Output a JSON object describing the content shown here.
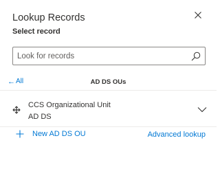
{
  "dialog": {
    "title": "Lookup Records",
    "subtitle": "Select record"
  },
  "search": {
    "placeholder": "Look for records",
    "value": ""
  },
  "nav": {
    "back_label": "All",
    "entity_label": "AD DS OUs"
  },
  "results": [
    {
      "name": "CCS Organizational Unit",
      "subtitle": "AD DS"
    }
  ],
  "footer": {
    "new_label": "New AD DS OU",
    "advanced_label": "Advanced lookup"
  },
  "colors": {
    "accent": "#0078d4",
    "text": "#323130",
    "border": "#8a8886",
    "divider": "#edebe9"
  },
  "icons": [
    "close-icon",
    "search-icon",
    "back-arrow-icon",
    "record-move-icon",
    "chevron-down-icon",
    "plus-icon"
  ]
}
